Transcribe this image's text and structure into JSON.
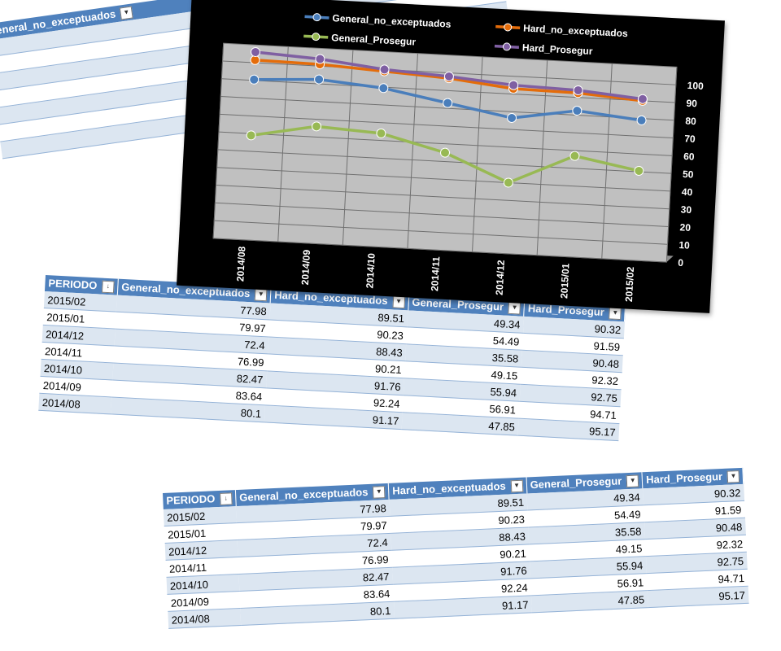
{
  "table": {
    "headers": [
      "PERIODO",
      "General_no_exceptuados",
      "Hard_no_exceptuados",
      "General_Prosegur",
      "Hard_Prosegur"
    ],
    "rows": [
      [
        "2015/02",
        "77.98",
        "89.51",
        "49.34",
        "90.32"
      ],
      [
        "2015/01",
        "79.97",
        "90.23",
        "54.49",
        "91.59"
      ],
      [
        "2014/12",
        "72.4",
        "88.43",
        "35.58",
        "90.48"
      ],
      [
        "2014/11",
        "76.99",
        "90.21",
        "49.15",
        "92.32"
      ],
      [
        "2014/10",
        "82.47",
        "91.76",
        "55.94",
        "92.75"
      ],
      [
        "2014/09",
        "83.64",
        "92.24",
        "56.91",
        "94.71"
      ],
      [
        "2014/08",
        "80.1",
        "91.17",
        "47.85",
        "95.17"
      ]
    ]
  },
  "chart_data": {
    "type": "line",
    "categories": [
      "2014/08",
      "2014/09",
      "2014/10",
      "2014/11",
      "2014/12",
      "2015/01",
      "2015/02"
    ],
    "series": [
      {
        "name": "General_no_exceptuados",
        "color": "#4a7ebb",
        "values": [
          90.5,
          92.5,
          89.5,
          83,
          76.5,
          82.5,
          79
        ]
      },
      {
        "name": "Hard_no_exceptuados",
        "color": "#e46c0a",
        "values": [
          101.5,
          101,
          99,
          97,
          93,
          92.5,
          90
        ]
      },
      {
        "name": "General_Prosegur",
        "color": "#98b954",
        "values": [
          59,
          66,
          64,
          55,
          40,
          57,
          50.5
        ]
      },
      {
        "name": "Hard_Prosegur",
        "color": "#7f5fa2",
        "values": [
          106,
          104,
          100,
          98,
          95,
          94,
          91
        ]
      }
    ],
    "y_ticks": [
      "0",
      "10",
      "20",
      "30",
      "40",
      "50",
      "60",
      "70",
      "80",
      "90",
      "100"
    ],
    "ylim": [
      0,
      110
    ],
    "grid": true,
    "legend_position": "top",
    "background": "#000000",
    "plot_background": "#c0c0c0"
  }
}
